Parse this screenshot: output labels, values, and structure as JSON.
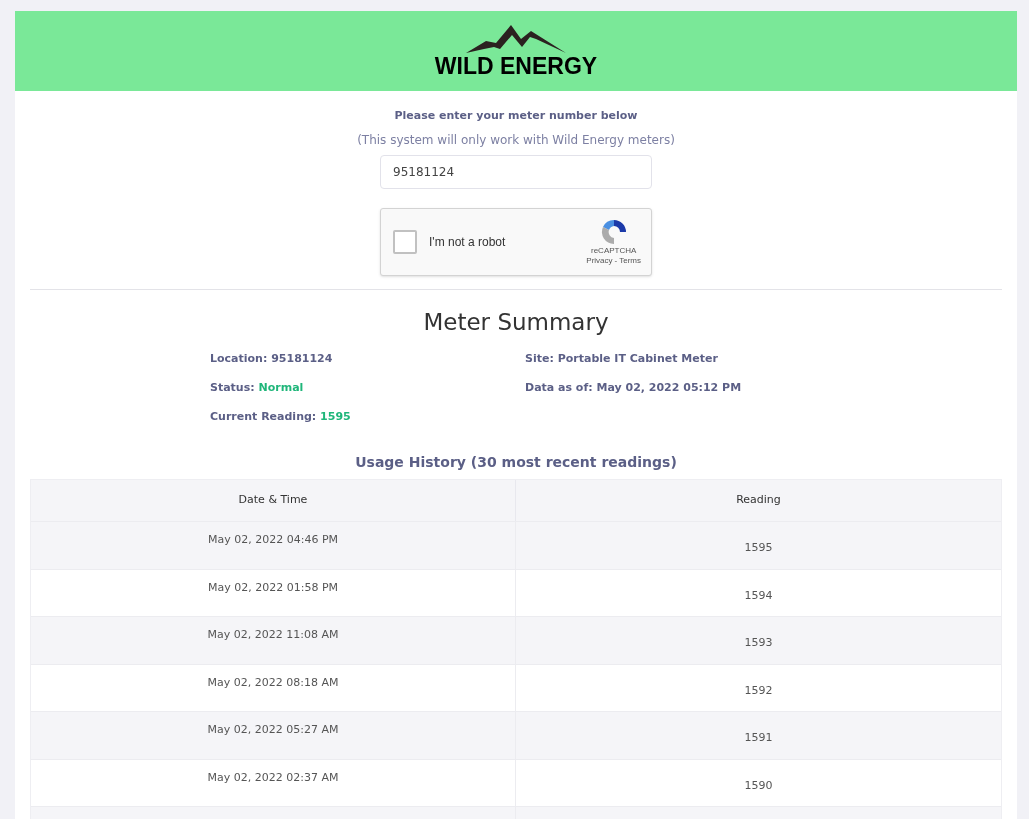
{
  "header": {
    "logo_text": "WILD ENERGY"
  },
  "form": {
    "prompt": "Please enter your meter number below",
    "hint": "(This system will only work with Wild Energy meters)",
    "meter_number": "95181124",
    "captcha": {
      "label": "I'm not a robot",
      "checked": false,
      "brand": "reCAPTCHA",
      "links": [
        "Privacy",
        "Terms"
      ],
      "separator": "-"
    }
  },
  "summary": {
    "title": "Meter Summary",
    "fields": [
      {
        "label": "Location:",
        "value": "95181124",
        "highlight": false
      },
      {
        "label": "Site:",
        "value": "Portable IT Cabinet Meter",
        "highlight": false
      },
      {
        "label": "Status:",
        "value": "Normal",
        "highlight": true
      },
      {
        "label": "Data as of:",
        "value": "May 02, 2022 05:12 PM",
        "highlight": false
      },
      {
        "label": "Current Reading:",
        "value": "1595",
        "highlight": true
      }
    ]
  },
  "history": {
    "title": "Usage History (30 most recent readings)",
    "columns": [
      "Date & Time",
      "Reading"
    ],
    "rows": [
      [
        "May 02, 2022 04:46 PM",
        "1595"
      ],
      [
        "May 02, 2022 01:58 PM",
        "1594"
      ],
      [
        "May 02, 2022 11:08 AM",
        "1593"
      ],
      [
        "May 02, 2022 08:18 AM",
        "1592"
      ],
      [
        "May 02, 2022 05:27 AM",
        "1591"
      ],
      [
        "May 02, 2022 02:37 AM",
        "1590"
      ]
    ]
  }
}
